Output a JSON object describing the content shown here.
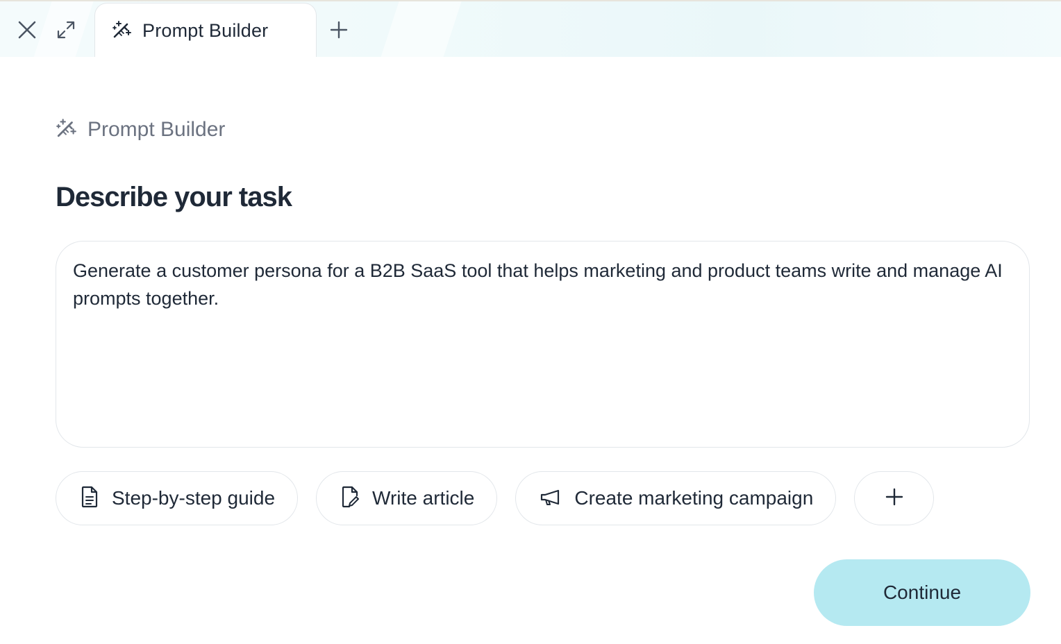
{
  "tabbar": {
    "close_icon": "close-icon",
    "expand_icon": "expand-icon",
    "new_tab_icon": "plus-icon",
    "tabs": [
      {
        "label": "Prompt Builder",
        "icon": "magic-wand-icon",
        "active": true
      }
    ]
  },
  "header": {
    "title": "Prompt Builder",
    "icon": "magic-wand-icon"
  },
  "main": {
    "heading": "Describe your task",
    "task_input": {
      "value": "Generate a customer persona for a B2B SaaS tool that helps marketing and product teams write and manage AI prompts together."
    },
    "chips": [
      {
        "label": "Step-by-step guide",
        "icon": "document-icon"
      },
      {
        "label": "Write article",
        "icon": "file-pen-icon"
      },
      {
        "label": "Create marketing campaign",
        "icon": "megaphone-icon"
      }
    ],
    "add_chip_icon": "plus-icon",
    "continue_label": "Continue"
  },
  "colors": {
    "continue_bg": "#b5e9f1",
    "heading_text": "#1f2937",
    "muted_text": "#6b7280",
    "border": "#e2e6ea"
  }
}
